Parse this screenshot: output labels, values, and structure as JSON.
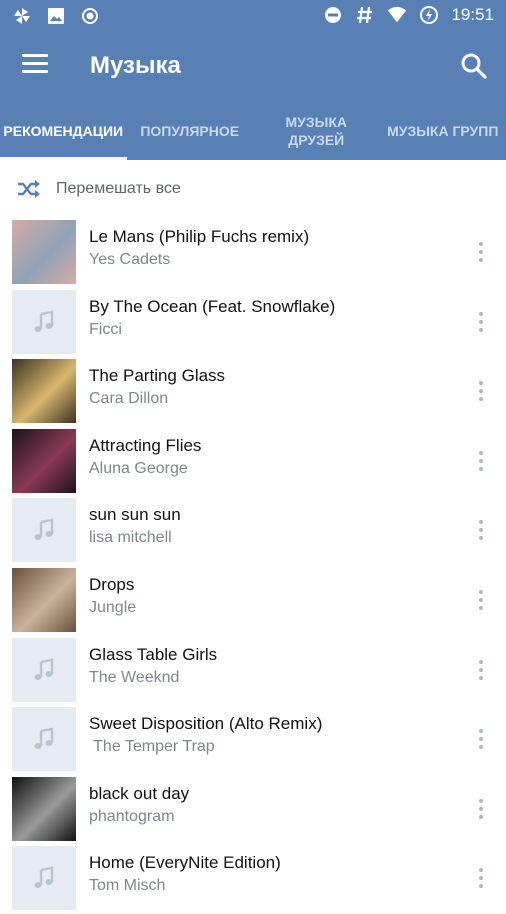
{
  "status_bar": {
    "time": "19:51",
    "icons_left": [
      "pinwheel-icon",
      "image-icon",
      "record-icon"
    ],
    "icons_right": [
      "do-not-disturb-icon",
      "hash-icon",
      "wifi-icon",
      "battery-icon"
    ]
  },
  "app_bar": {
    "title": "Музыка",
    "menu_icon": "menu-icon",
    "search_icon": "search-icon",
    "color": "#5880b5"
  },
  "tabs": [
    {
      "label": "РЕКОМЕНДАЦИИ",
      "active": true
    },
    {
      "label": "ПОПУЛЯРНОЕ",
      "active": false
    },
    {
      "label": "МУЗЫКА ДРУЗЕЙ",
      "active": false
    },
    {
      "label": "МУЗЫКА ГРУПП",
      "active": false
    }
  ],
  "shuffle": {
    "label": "Перемешать все",
    "icon": "shuffle-icon"
  },
  "tracks": [
    {
      "title": "Le Mans (Philip Fuchs remix)",
      "artist": "Yes Cadets",
      "cover": "art",
      "colors": [
        "#d8a9a5",
        "#8fa3b6"
      ]
    },
    {
      "title": "By The Ocean (Feat. Snowflake)",
      "artist": "Ficci",
      "cover": "placeholder"
    },
    {
      "title": "The Parting Glass",
      "artist": "Cara Dillon",
      "cover": "art",
      "colors": [
        "#3c3322",
        "#d7b76e"
      ]
    },
    {
      "title": "Attracting Flies",
      "artist": "Aluna George",
      "cover": "art",
      "colors": [
        "#1b1419",
        "#8b3a56"
      ]
    },
    {
      "title": "sun sun sun",
      "artist": "lisa mitchell",
      "cover": "placeholder"
    },
    {
      "title": "Drops",
      "artist": "Jungle",
      "cover": "art",
      "colors": [
        "#6b4f3a",
        "#c9b49a"
      ]
    },
    {
      "title": "Glass Table Girls",
      "artist": "The Weeknd",
      "cover": "placeholder"
    },
    {
      "title": "Sweet Disposition (Alto Remix)",
      "artist": " The Temper Trap",
      "cover": "placeholder"
    },
    {
      "title": "black out day",
      "artist": "phantogram",
      "cover": "art",
      "colors": [
        "#111111",
        "#9a9a9a"
      ]
    },
    {
      "title": "Home (EveryNite Edition)",
      "artist": "Tom Misch",
      "cover": "placeholder"
    }
  ]
}
